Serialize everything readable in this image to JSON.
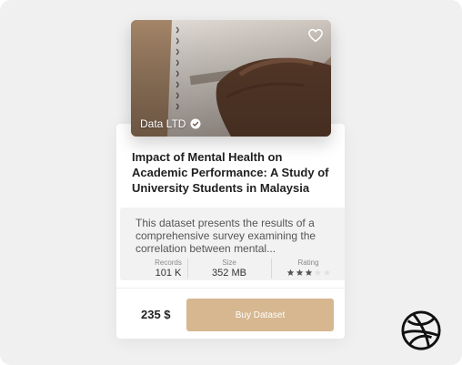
{
  "card": {
    "publisher": "Data LTD",
    "title": "Impact of Mental Health on Academic Performance: A Study of University Students in Malaysia",
    "description": "This dataset presents the results of a comprehensive survey examining the correlation between mental...",
    "stats": {
      "records_label": "Records",
      "records_value": "101 K",
      "size_label": "Size",
      "size_value": "352 MB",
      "rating_label": "Rating",
      "rating_value": 3,
      "rating_max": 5
    },
    "price": "235 $",
    "buy_label": "Buy Dataset"
  },
  "icons": {
    "favorite": "heart-icon",
    "verified": "check-badge-icon",
    "brand": "dribbble-logo-icon"
  },
  "colors": {
    "accent": "#d6b790",
    "page_background": "#f0f0f0",
    "info_background": "#f2f2f2",
    "star_filled": "#555555",
    "star_empty": "#e2e2e2"
  }
}
